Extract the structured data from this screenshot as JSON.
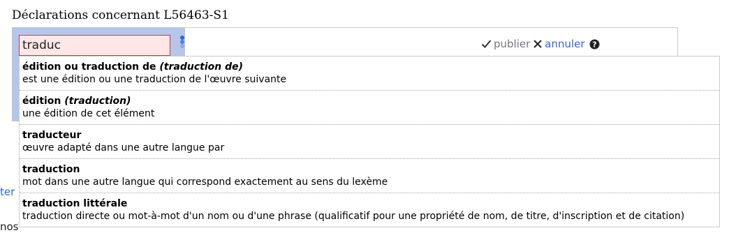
{
  "heading": "Déclarations concernant L56463-S1",
  "property_input": {
    "value": "traduc"
  },
  "toolbar": {
    "publish_label": "publier",
    "cancel_label": "annuler"
  },
  "suggestions": [
    {
      "label": "édition ou traduction de",
      "alias": "(traduction de)",
      "description": "est une édition ou une traduction de l'œuvre suivante"
    },
    {
      "label": "édition",
      "alias": "(traduction)",
      "description": "une édition de cet élément"
    },
    {
      "label": "traducteur",
      "alias": "",
      "description": "œuvre adapté dans une autre langue par"
    },
    {
      "label": "traduction",
      "alias": "",
      "description": "mot dans une autre langue qui correspond exactement au sens du lexème"
    },
    {
      "label": "traduction littérale",
      "alias": "",
      "description": "traduction directe ou mot-à-mot d'un nom ou d'une phrase (qualificatif pour une propriété de nom, de titre, d'inscription et de citation)"
    }
  ],
  "left_link": "ter",
  "cut_text": "nos"
}
